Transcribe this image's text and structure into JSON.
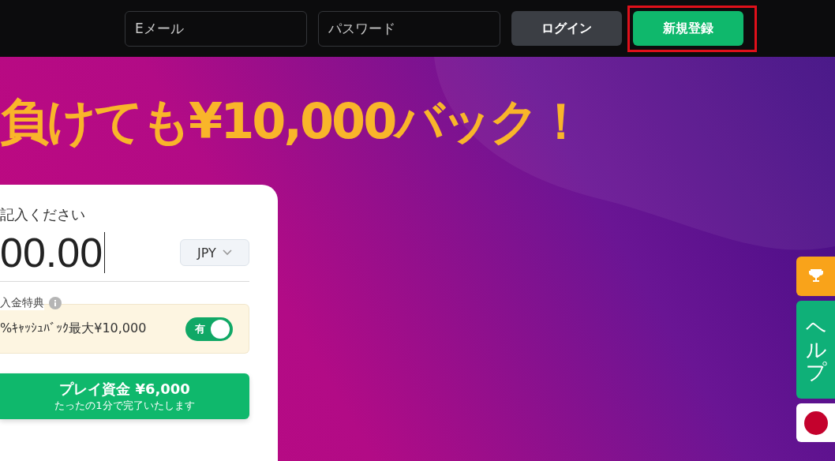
{
  "header": {
    "email_field": {
      "placeholder": "Eメール"
    },
    "password_field": {
      "placeholder": "パスワード"
    },
    "login_button": "ログイン",
    "signup_button": {
      "label": "新規登録",
      "highlighted": true
    }
  },
  "hero": {
    "headline": "負けても¥10,000バック！"
  },
  "deposit_card": {
    "prompt": "記入ください",
    "amount": "00.00",
    "currency": "JPY",
    "bonus": {
      "label": "入金特典",
      "text": "%ｷｬｯｼｭﾊﾞｯｸ最大¥10,000",
      "toggle": {
        "label": "有",
        "on": true
      }
    },
    "play_button": {
      "title": "プレイ資金 ¥6,000",
      "subtitle": "たったの1分で完了いたします"
    }
  },
  "side_tabs": [
    {
      "kind": "trophy"
    },
    {
      "kind": "help",
      "label": "ヘルプ"
    },
    {
      "kind": "flag"
    }
  ]
}
